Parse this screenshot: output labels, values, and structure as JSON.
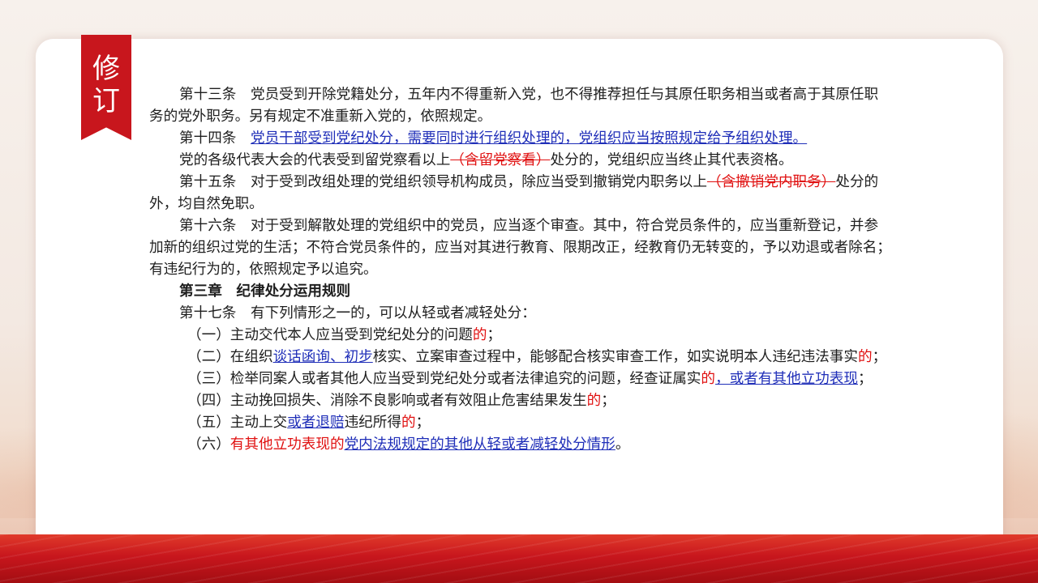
{
  "ribbon": {
    "char1": "修",
    "char2": "订"
  },
  "article13": {
    "line1": "第十三条　党员受到开除党籍处分，五年内不得重新入党，也不得推荐担任与其原任职务相当或者高于其原任职",
    "line2": "务的党外职务。另有规定不准重新入党的，依照规定。"
  },
  "article14": {
    "head": "第十四条　",
    "inserted": "党员干部受到党纪处分，需要同时进行组织处理的，党组织应当按照规定给予组织处理。",
    "p2_before": "党的各级代表大会的代表受到留党察看以上",
    "p2_deleted": "（含留党察看）",
    "p2_after": "处分的，党组织应当终止其代表资格。"
  },
  "article15": {
    "before": "第十五条　对于受到改组处理的党组织领导机构成员，除应当受到撤销党内职务以上",
    "deleted": "（含撤销党内职务）",
    "after": "处分的",
    "line2": "外，均自然免职。"
  },
  "article16": {
    "line1": "第十六条　对于受到解散处理的党组织中的党员，应当逐个审查。其中，符合党员条件的，应当重新登记，并参",
    "line2": "加新的组织过党的生活；不符合党员条件的，应当对其进行教育、限期改正，经教育仍无转变的，予以劝退或者除名；",
    "line3": "有违纪行为的，依照规定予以追究。"
  },
  "chapter3": {
    "title": "第三章　纪律处分运用规则"
  },
  "article17": {
    "intro": "第十七条　有下列情形之一的，可以从轻或者减轻处分：",
    "items": [
      {
        "a": "（一）主动交代本人应当受到党纪处分的问题",
        "del": "的",
        "b": "；"
      },
      {
        "a": "（二）在组织",
        "ins": "谈话函询、初步",
        "b": "核实、立案审查过程中，能够配合核实审查工作，如实说明本人违纪违法事实",
        "del": "的",
        "c": "；"
      },
      {
        "a": "（三）检举同案人或者其他人应当受到党纪处分或者法律追究的问题，经查证属实",
        "del": "的",
        "ins": "，或者有其他立功表现",
        "b": "；"
      },
      {
        "a": "（四）主动挽回损失、消除不良影响或者有效阻止危害结果发生",
        "del": "的",
        "b": "；"
      },
      {
        "a": "（五）主动上交",
        "ins": "或者退赔",
        "b": "违纪所得",
        "del": "的",
        "c": "；"
      },
      {
        "a": "（六）",
        "del": "有其他立功表现的",
        "ins": "党内法规规定的其他从轻或者减轻处分情形",
        "b": "。"
      }
    ]
  },
  "colors": {
    "accent_red": "#c8161d",
    "inserted_blue": "#1f2eb8",
    "deleted_red": "#e01010"
  }
}
